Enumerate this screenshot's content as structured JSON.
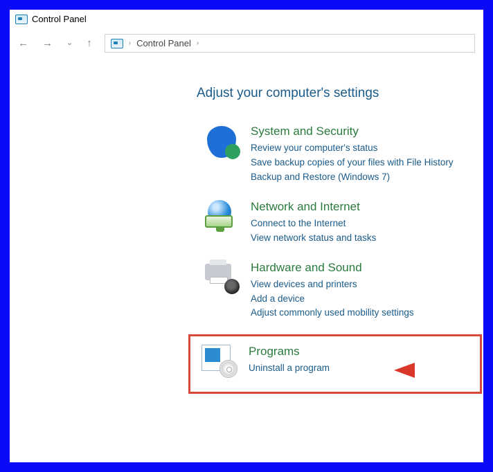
{
  "window": {
    "title": "Control Panel"
  },
  "breadcrumb": {
    "root": "Control Panel"
  },
  "heading": "Adjust your computer's settings",
  "categories": [
    {
      "title": "System and Security",
      "links": [
        "Review your computer's status",
        "Save backup copies of your files with File History",
        "Backup and Restore (Windows 7)"
      ]
    },
    {
      "title": "Network and Internet",
      "links": [
        "Connect to the Internet",
        "View network status and tasks"
      ]
    },
    {
      "title": "Hardware and Sound",
      "links": [
        "View devices and printers",
        "Add a device",
        "Adjust commonly used mobility settings"
      ]
    },
    {
      "title": "Programs",
      "links": [
        "Uninstall a program"
      ]
    }
  ]
}
